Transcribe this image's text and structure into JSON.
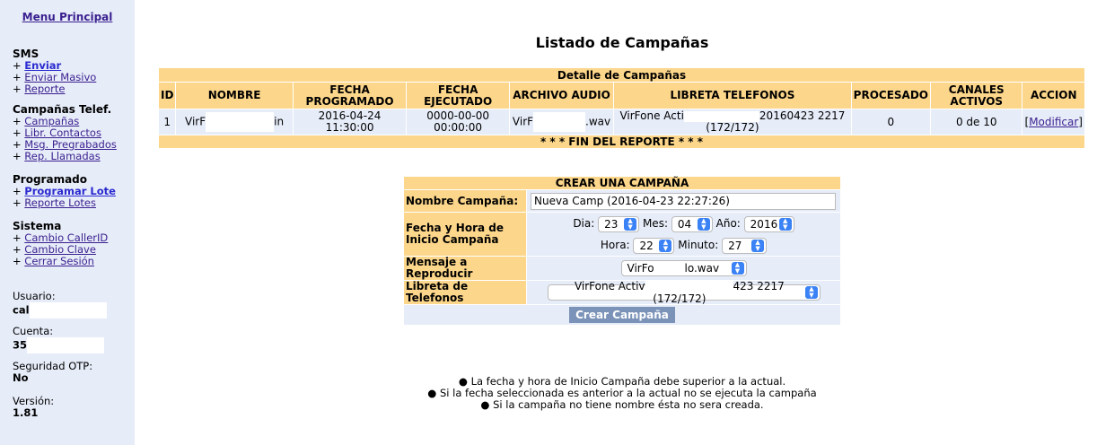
{
  "sidebar": {
    "menu_principal": "Menu Principal",
    "sections": [
      {
        "title": "SMS",
        "items": [
          {
            "label": "Enviar",
            "bold": true
          },
          {
            "label": "Enviar Masivo",
            "bold": false
          },
          {
            "label": "Reporte",
            "bold": false
          }
        ]
      },
      {
        "title": "Campañas Telef.",
        "items": [
          {
            "label": "Campañas",
            "bold": false
          },
          {
            "label": "Libr. Contactos",
            "bold": false
          },
          {
            "label": "Msg. Pregrabados",
            "bold": false
          },
          {
            "label": "Rep. Llamadas",
            "bold": false
          }
        ]
      },
      {
        "title": "Programado",
        "items": [
          {
            "label": "Programar Lote",
            "bold": true
          },
          {
            "label": "Reporte Lotes",
            "bold": false
          }
        ]
      },
      {
        "title": "Sistema",
        "items": [
          {
            "label": "Cambio CallerID",
            "bold": false
          },
          {
            "label": "Cambio Clave",
            "bold": false
          },
          {
            "label": "Cerrar Sesión",
            "bold": false
          }
        ]
      }
    ],
    "plus": "+",
    "info": {
      "usuario_label": "Usuario:",
      "usuario_value": "cal",
      "cuenta_label": "Cuenta:",
      "cuenta_value": "35",
      "otp_label": "Seguridad OTP:",
      "otp_value": "No",
      "version_label": "Versión:",
      "version_value": "1.81"
    }
  },
  "page_title": "Listado de Campañas",
  "report": {
    "section_title": "Detalle de Campañas",
    "columns": [
      "ID",
      "NOMBRE",
      "FECHA PROGRAMADO",
      "FECHA EJECUTADO",
      "ARCHIVO AUDIO",
      "LIBRETA TELEFONOS",
      "PROCESADO",
      "CANALES ACTIVOS",
      "ACCION"
    ],
    "rows": [
      {
        "id": "1",
        "nombre_a": "VirF",
        "nombre_b": "in",
        "fecha_programado": "2016-04-24 11:30:00",
        "fecha_ejecutado": "0000-00-00 00:00:00",
        "archivo_a": "VirF",
        "archivo_b": ".wav",
        "libreta_a": "VirFone Acti",
        "libreta_b": "20160423 2217",
        "libreta_c": "(172/172)",
        "procesado": "0",
        "canales": "0 de 10",
        "accion_open": "[",
        "accion_link": "Modificar",
        "accion_close": "]"
      }
    ],
    "footer": "* * * FIN DEL REPORTE * * *"
  },
  "create": {
    "title": "CREAR UNA CAMPAÑA",
    "nombre_label": "Nombre Campaña:",
    "nombre_value": "Nueva Camp (2016-04-23 22:27:26)",
    "fecha_label": "Fecha y Hora de Inicio Campaña",
    "dia_label": "Dia:",
    "dia_value": "23",
    "mes_label": "Mes:",
    "mes_value": "04",
    "anio_label": "Año:",
    "anio_value": "2016",
    "hora_label": "Hora:",
    "hora_value": "22",
    "minuto_label": "Minuto:",
    "minuto_value": "27",
    "mensaje_label": "Mensaje a Reproducir",
    "mensaje_a": "VirFo",
    "mensaje_b": "lo.wav",
    "libreta_label": "Libreta de Telefonos",
    "libreta_a": "VirFone Activ",
    "libreta_b": "423 2217 (172/172)",
    "submit": "Crear Campaña"
  },
  "notes": [
    "La fecha y hora de Inicio Campaña debe superior a la actual.",
    "Si la fecha seleccionada es anterior a la actual no se ejecuta la campaña",
    "Si la campaña no tiene nombre ésta no sera creada."
  ],
  "bullet": "●",
  "colors": {
    "sidebar_bg": "#e6ecf8",
    "header_bg": "#fcd68a",
    "button_bg": "#7b93b8",
    "link": "#3a1f8f"
  }
}
